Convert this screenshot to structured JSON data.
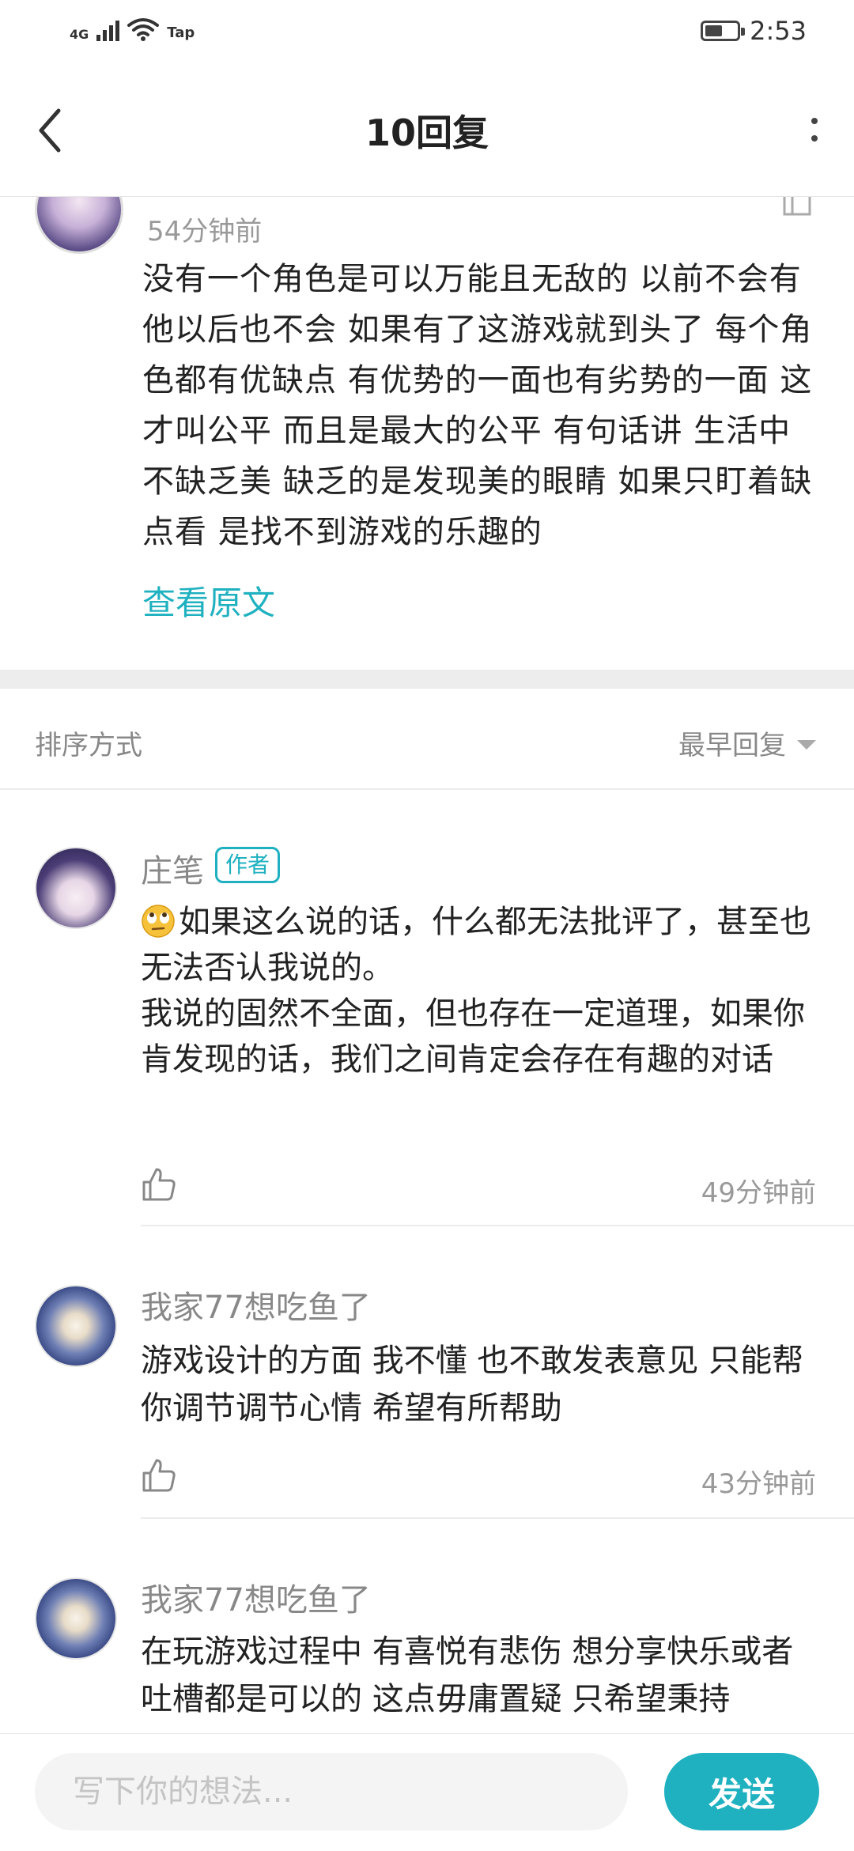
{
  "status_bar": {
    "network": "4G",
    "extra": "Tap",
    "time": "2:53",
    "battery_level": 0.55
  },
  "header": {
    "title": "10回复",
    "back_icon": "chevron-left-icon",
    "more_icon": "more-vertical-icon"
  },
  "main_comment": {
    "time": "54分钟前",
    "body": "没有一个角色是可以万能且无敌的 以前不会有他以后也不会 如果有了这游戏就到头了 每个角色都有优缺点 有优势的一面也有劣势的一面 这才叫公平 而且是最大的公平 有句话讲 生活中不缺乏美 缺乏的是发现美的眼睛 如果只盯着缺点看 是找不到游戏的乐趣的",
    "view_original": "查看原文"
  },
  "sort": {
    "label": "排序方式",
    "selected": "最早回复"
  },
  "replies": [
    {
      "name": "庄笔",
      "badge": "作者",
      "body_line1": "如果这么说的话，什么都无法批评了，甚至也无法否认我说的。",
      "body_line2": "我说的固然不全面，但也存在一定道理，如果你肯发现的话，我们之间肯定会存在有趣的对话",
      "emoji": "eye-roll-emoji",
      "time": "49分钟前"
    },
    {
      "name": "我家77想吃鱼了",
      "body": "游戏设计的方面 我不懂 也不敢发表意见 只能帮你调节调节心情 希望有所帮助",
      "time": "43分钟前"
    },
    {
      "name": "我家77想吃鱼了",
      "body": "在玩游戏过程中 有喜悦有悲伤 想分享快乐或者吐槽都是可以的 这点毋庸置疑 只希望秉持"
    }
  ],
  "composer": {
    "placeholder": "写下你的想法...",
    "send_label": "发送"
  },
  "colors": {
    "accent": "#1fb1c0",
    "muted_text": "#888888",
    "divider": "#ececec"
  }
}
